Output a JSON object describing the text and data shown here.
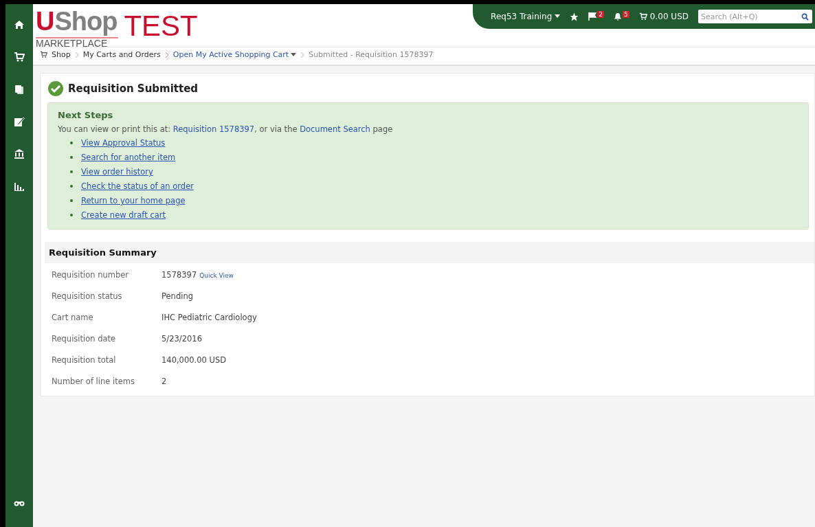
{
  "logo": {
    "mark": "U",
    "name": "Shop",
    "sub": "MARKETPLACE",
    "env": "TEST"
  },
  "topbar": {
    "user": "Req53 Training",
    "flags": "2",
    "alerts": "5",
    "cart_total": "0.00 USD",
    "search_placeholder": "Search (Alt+Q)"
  },
  "sidebar": {
    "items": [
      {
        "kind": "home"
      },
      {
        "kind": "cart"
      },
      {
        "kind": "docs"
      },
      {
        "kind": "edit"
      },
      {
        "kind": "bank"
      },
      {
        "kind": "chart"
      }
    ],
    "bottom": {
      "kind": "binoculars"
    }
  },
  "breadcrumb": [
    {
      "label": "Shop",
      "kind": "plain"
    },
    {
      "label": "My Carts and Orders",
      "kind": "plain"
    },
    {
      "label": "Open My Active Shopping Cart",
      "kind": "link"
    },
    {
      "label": "Submitted - Requisition 1578397",
      "kind": "current"
    }
  ],
  "title": "Requisition Submitted",
  "next_steps": {
    "heading": "Next Steps",
    "intro": "You can view or print this at:",
    "req_link": "Requisition 1578397",
    "middle": ", or via the",
    "doc_link": "Document Search",
    "end": "page",
    "links": [
      "View Approval Status",
      "Search for another item",
      "View order history",
      "Check the status of an order",
      "Return to your home page",
      "Create new draft cart"
    ]
  },
  "summary": {
    "heading": "Requisition Summary",
    "quick_view": "Quick View",
    "rows": [
      {
        "label": "Requisition number",
        "value": "1578397"
      },
      {
        "label": "Requisition status",
        "value": "Pending"
      },
      {
        "label": "Cart name",
        "value": "IHC Pediatric Cardiology"
      },
      {
        "label": "Requisition date",
        "value": "5/23/2016"
      },
      {
        "label": "Requisition total",
        "value": "140,000.00 USD"
      },
      {
        "label": "Number of line items",
        "value": "2"
      }
    ]
  }
}
